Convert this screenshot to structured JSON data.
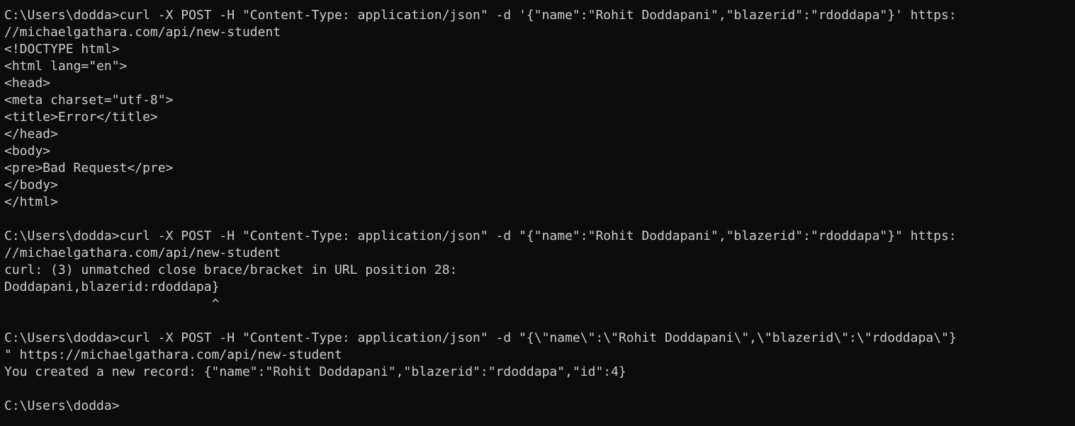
{
  "terminal": {
    "lines": [
      "C:\\Users\\dodda>curl -X POST -H \"Content-Type: application/json\" -d '{\"name\":\"Rohit Doddapani\",\"blazerid\":\"rdoddapa\"}' https:",
      "//michaelgathara.com/api/new-student",
      "<!DOCTYPE html>",
      "<html lang=\"en\">",
      "<head>",
      "<meta charset=\"utf-8\">",
      "<title>Error</title>",
      "</head>",
      "<body>",
      "<pre>Bad Request</pre>",
      "</body>",
      "</html>",
      "",
      "C:\\Users\\dodda>curl -X POST -H \"Content-Type: application/json\" -d \"{\"name\":\"Rohit Doddapani\",\"blazerid\":\"rdoddapa\"}\" https:",
      "//michaelgathara.com/api/new-student",
      "curl: (3) unmatched close brace/bracket in URL position 28:",
      "Doddapani,blazerid:rdoddapa}",
      "                           ^",
      "",
      "C:\\Users\\dodda>curl -X POST -H \"Content-Type: application/json\" -d \"{\\\"name\\\":\\\"Rohit Doddapani\\\",\\\"blazerid\\\":\\\"rdoddapa\\\"}",
      "\" https://michaelgathara.com/api/new-student",
      "You created a new record: {\"name\":\"Rohit Doddapani\",\"blazerid\":\"rdoddapa\",\"id\":4}",
      "",
      "C:\\Users\\dodda>"
    ]
  }
}
